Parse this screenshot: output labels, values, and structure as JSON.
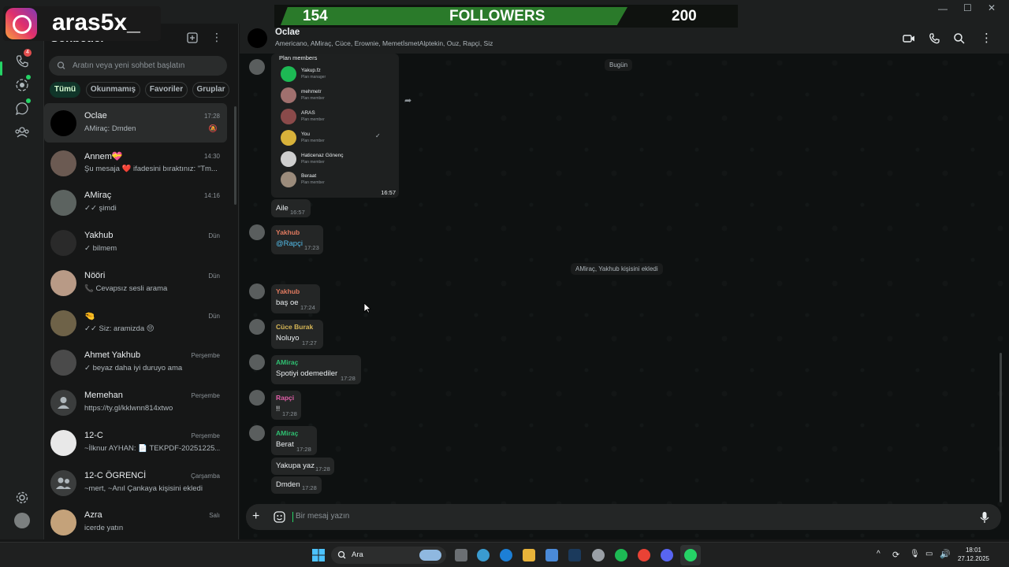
{
  "stream_overlay": {
    "ig_handle": "aras5x_",
    "followers_current": "154",
    "followers_label": "FOLLOWERS",
    "followers_goal": "200"
  },
  "rail": {
    "calls_badge": "4"
  },
  "chatlist": {
    "title": "Sohbetler",
    "search_placeholder": "Aratın veya yeni sohbet başlatın",
    "filters": [
      "Tümü",
      "Okunmamış",
      "Favoriler",
      "Gruplar"
    ],
    "rows": [
      {
        "name": "Oclae",
        "time": "17:28",
        "last": "AMiraç: Dmden"
      },
      {
        "name": "Annem💝",
        "time": "14:30",
        "last": "Şu mesaja ❤️ ifadesini bıraktınız: \"Tm..."
      },
      {
        "name": "AMiraç",
        "time": "14:16",
        "last": "✓✓ şimdi"
      },
      {
        "name": "Yakhub",
        "time": "Dün",
        "last": "✓ bilmem"
      },
      {
        "name": "Nööri",
        "time": "Dün",
        "last": "📞 Cevapsız sesli arama"
      },
      {
        "name": "🤏",
        "time": "Dün",
        "last": "✓✓ Siz: aramizda 😔"
      },
      {
        "name": "Ahmet Yakhub",
        "time": "Perşembe",
        "last": "✓ beyaz daha iyi duruyo ama"
      },
      {
        "name": "Memehan",
        "time": "Perşembe",
        "last": "https://ty.gl/kklwnn814xtwo"
      },
      {
        "name": "12-C",
        "time": "Perşembe",
        "last": "~İlknur AYHAN: 📄 TEKPDF-20251225..."
      },
      {
        "name": "12-C ÖGRENCİ",
        "time": "Çarşamba",
        "last": "~mert, ~Anıl Çankaya kişisini ekledi"
      },
      {
        "name": "Azra",
        "time": "Salı",
        "last": "icerde yatın"
      }
    ]
  },
  "chat": {
    "name": "Oclae",
    "members": "Americano, AMiraç, Cüce, Erownie, MemetİsmetAlptekin, Ouz, Rapçi, Siz",
    "day_label": "Bugün",
    "plan": {
      "title": "Plan members",
      "time": "16:57",
      "members": [
        {
          "name": "Yakup.fz",
          "role": "Plan manager"
        },
        {
          "name": "mehmetr",
          "role": "Plan member"
        },
        {
          "name": "ARAS",
          "role": "Plan member"
        },
        {
          "name": "You",
          "role": "Plan member"
        },
        {
          "name": "Haticenaz Gönenç",
          "role": "Plan member"
        },
        {
          "name": "Beraat",
          "role": "Plan member"
        }
      ]
    },
    "messages": [
      {
        "sender": "",
        "text": "Aile",
        "time": "16:57"
      },
      {
        "sender": "Yakhub",
        "text": "@Rapçi",
        "time": "17:23"
      },
      {
        "sender": "Yakhub",
        "text": "baş oe",
        "time": "17:24"
      },
      {
        "sender": "Cüce Burak",
        "text": "Noluyo",
        "time": "17:27"
      },
      {
        "sender": "AMiraç",
        "text": "Spotiyi odemediler",
        "time": "17:28"
      },
      {
        "sender": "Rapçi",
        "text": "!!",
        "time": "17:28"
      },
      {
        "sender": "AMiraç",
        "text": "Berat",
        "time": "17:28"
      },
      {
        "sender": "",
        "text": "Yakupa yaz",
        "time": "17:28"
      },
      {
        "sender": "",
        "text": "Dmden",
        "time": "17:28"
      }
    ],
    "system_msg": "AMiraç, Yakhub kişisini ekledi",
    "composer_placeholder": "Bir mesaj yazın"
  },
  "taskbar": {
    "search_label": "Ara",
    "clock_time": "18:01",
    "clock_date": "27.12.2025"
  },
  "colors": {
    "accent": "#25d366",
    "yakhub": "#e07a5f",
    "cuce": "#d6b656",
    "amirac": "#2fbf71",
    "rapci": "#e05fa8"
  }
}
